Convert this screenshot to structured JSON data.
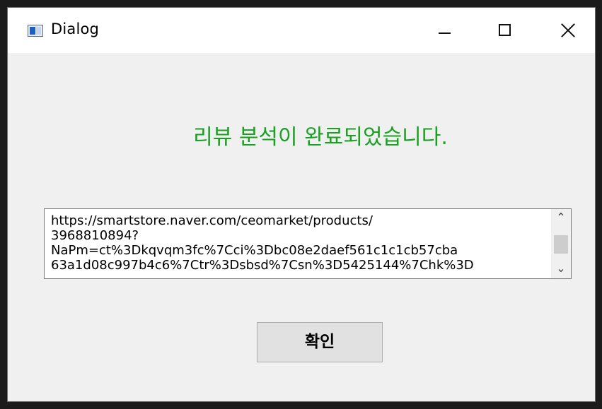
{
  "window": {
    "title": "Dialog",
    "icon": "app-window-icon"
  },
  "controls": {
    "minimize_icon": "minimize-icon",
    "maximize_icon": "maximize-icon",
    "close_icon": "close-icon"
  },
  "message": {
    "text": "리뷰 분석이 완료되었습니다.",
    "color": "#18a020"
  },
  "url_box": {
    "value": "https://smartstore.naver.com/ceomarket/products/\n3968810894?\nNaPm=ct%3Dkqvqm3fc%7Cci%3Dbc08e2daef561c1c1cb57cba\n63a1d08c997b4c6%7Ctr%3Dsbsd%7Csn%3D5425144%7Chk%3D"
  },
  "ok_button": {
    "label": "확인"
  }
}
